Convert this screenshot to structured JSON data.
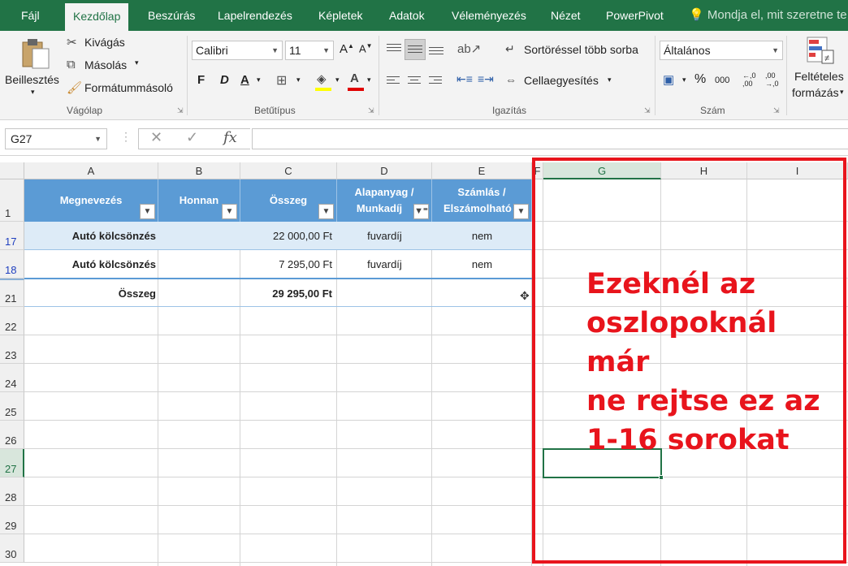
{
  "ribbon_tabs": [
    "Fájl",
    "Kezdőlap",
    "Beszúrás",
    "Lapelrendezés",
    "Képletek",
    "Adatok",
    "Véleményezés",
    "Nézet",
    "PowerPivot"
  ],
  "tell_me": "Mondja el, mit szeretne te",
  "clipboard": {
    "paste": "Beillesztés",
    "cut": "Kivágás",
    "copy": "Másolás",
    "format_painter": "Formátummásoló",
    "group": "Vágólap"
  },
  "font": {
    "family": "Calibri",
    "size": "11",
    "bold": "F",
    "italic": "D",
    "underline": "A",
    "group": "Betűtípus"
  },
  "alignment": {
    "wrap": "Sortöréssel több sorba",
    "merge": "Cellaegyesítés",
    "group": "Igazítás"
  },
  "number": {
    "format": "Általános",
    "percent": "%",
    "thousands": "000",
    "group": "Szám"
  },
  "styles": {
    "conditional": "Feltételes",
    "conditional2": "formázás"
  },
  "formula_bar": {
    "name_box": "G27",
    "cancel": "✕",
    "enter": "✓",
    "fx": "fx",
    "value": ""
  },
  "columns": [
    "A",
    "B",
    "C",
    "D",
    "E",
    "F",
    "G",
    "H",
    "I"
  ],
  "rows": [
    "1",
    "17",
    "18",
    "21",
    "22",
    "23",
    "24",
    "25",
    "26",
    "27",
    "28",
    "29",
    "30"
  ],
  "table": {
    "headers": {
      "a": "Megnevezés",
      "b": "Honnan",
      "c": "Összeg",
      "d1": "Alapanyag /",
      "d2": "Munkadíj",
      "e1": "Számlás /",
      "e2": "Elszámolható"
    },
    "rows": [
      {
        "name": "Autó kölcsönzés",
        "from": "",
        "amount": "22 000,00 Ft",
        "type": "fuvardíj",
        "invoice": "nem"
      },
      {
        "name": "Autó kölcsönzés",
        "from": "",
        "amount": "7 295,00 Ft",
        "type": "fuvardíj",
        "invoice": "nem"
      }
    ],
    "total_label": "Összeg",
    "total_value": "29 295,00 Ft"
  },
  "annotation": "Ezeknél az\noszlopoknál már\nne rejtse ez az\n1-16 sorokat",
  "colors": {
    "excel_green": "#217346",
    "table_header": "#5b9bd5",
    "band": "#ddebf7",
    "annotation_red": "#e8141c"
  }
}
